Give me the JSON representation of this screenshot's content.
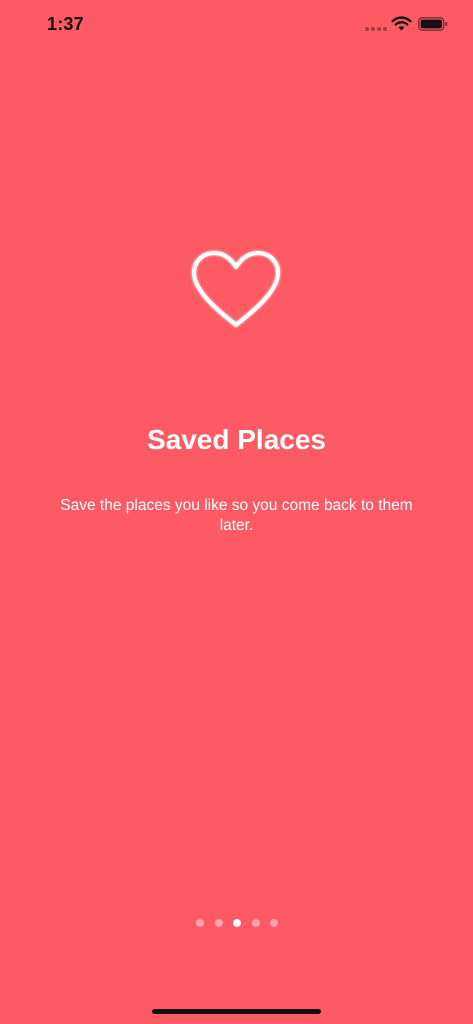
{
  "status_bar": {
    "time": "1:37",
    "icons": [
      "signal-dots-icon",
      "wifi-icon",
      "battery-icon"
    ]
  },
  "onboarding": {
    "icon": "heart-icon",
    "title": "Saved Places",
    "description": "Save the places you like so you come back to them later."
  },
  "pagination": {
    "total_pages": 5,
    "current_page": 3
  },
  "colors": {
    "background": "#FE5A64",
    "text": "#FFFFFF",
    "status_text": "#111111"
  }
}
